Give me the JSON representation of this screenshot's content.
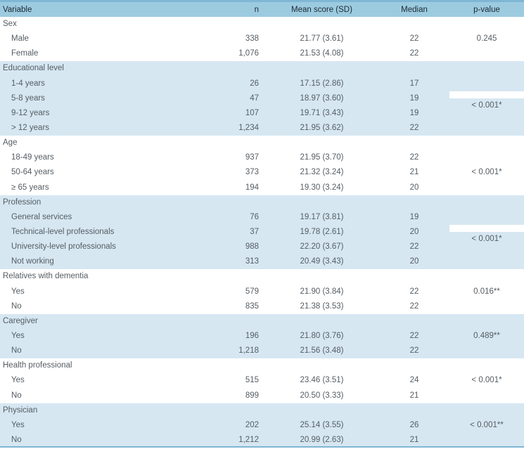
{
  "table": {
    "headers": {
      "variable": "Variable",
      "n": "n",
      "mean": "Mean score (SD)",
      "median": "Median",
      "p": "p-value"
    },
    "groups": [
      {
        "label": "Sex",
        "p": "0.245",
        "rows": [
          {
            "label": "Male",
            "n": "338",
            "mean": "21.77 (3.61)",
            "median": "22"
          },
          {
            "label": "Female",
            "n": "1,076",
            "mean": "21.53 (4.08)",
            "median": "22"
          }
        ]
      },
      {
        "label": "Educational level",
        "p": "< 0.001*",
        "rows": [
          {
            "label": "1-4 years",
            "n": "26",
            "mean": "17.15 (2.86)",
            "median": "17"
          },
          {
            "label": "5-8 years",
            "n": "47",
            "mean": "18.97 (3.60)",
            "median": "19"
          },
          {
            "label": "9-12 years",
            "n": "107",
            "mean": "19.71 (3.43)",
            "median": "19"
          },
          {
            "label": "> 12 years",
            "n": "1,234",
            "mean": "21.95 (3.62)",
            "median": "22"
          }
        ]
      },
      {
        "label": "Age",
        "p": "< 0.001*",
        "rows": [
          {
            "label": "18-49 years",
            "n": "937",
            "mean": "21.95 (3.70)",
            "median": "22"
          },
          {
            "label": "50-64 years",
            "n": "373",
            "mean": "21.32 (3.24)",
            "median": "21"
          },
          {
            "label": "≥ 65 years",
            "n": "194",
            "mean": "19.30 (3.24)",
            "median": "20"
          }
        ]
      },
      {
        "label": "Profession",
        "p": "< 0.001*",
        "rows": [
          {
            "label": "General services",
            "n": "76",
            "mean": "19.17 (3.81)",
            "median": "19"
          },
          {
            "label": "Technical-level professionals",
            "n": "37",
            "mean": "19.78 (2.61)",
            "median": "20"
          },
          {
            "label": "University-level professionals",
            "n": "988",
            "mean": "22.20 (3.67)",
            "median": "22"
          },
          {
            "label": "Not working",
            "n": "313",
            "mean": "20.49 (3.43)",
            "median": "20"
          }
        ]
      },
      {
        "label": "Relatives with dementia",
        "p": "0.016**",
        "rows": [
          {
            "label": "Yes",
            "n": "579",
            "mean": "21.90 (3.84)",
            "median": "22"
          },
          {
            "label": "No",
            "n": "835",
            "mean": "21.38 (3.53)",
            "median": "22"
          }
        ]
      },
      {
        "label": "Caregiver",
        "p": "0.489**",
        "rows": [
          {
            "label": "Yes",
            "n": "196",
            "mean": "21.80 (3.76)",
            "median": "22"
          },
          {
            "label": "No",
            "n": "1,218",
            "mean": "21.56 (3.48)",
            "median": "22"
          }
        ]
      },
      {
        "label": "Health professional",
        "p": "< 0.001*",
        "rows": [
          {
            "label": "Yes",
            "n": "515",
            "mean": "23.46 (3.51)",
            "median": "24"
          },
          {
            "label": "No",
            "n": "899",
            "mean": "20.50 (3.33)",
            "median": "21"
          }
        ]
      },
      {
        "label": "Physician",
        "p": "< 0.001**",
        "rows": [
          {
            "label": "Yes",
            "n": "202",
            "mean": "25.14 (3.55)",
            "median": "26"
          },
          {
            "label": "No",
            "n": "1,212",
            "mean": "20.99 (2.63)",
            "median": "21"
          }
        ]
      }
    ],
    "colors": {
      "header_bg": "#9ccbe0",
      "shade_bg": "#d6e7f2",
      "rule": "#7fb6d3"
    }
  }
}
